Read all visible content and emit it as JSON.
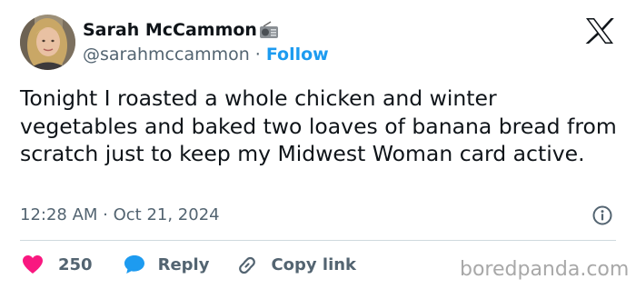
{
  "author": {
    "display_name": "Sarah McCammon",
    "handle": "@sarahmccammon",
    "separator": "·",
    "follow_label": "Follow"
  },
  "tweet": {
    "text": "Tonight I roasted a whole chicken and winter vegetables and baked two loaves of banana bread from scratch just to keep my Midwest Woman card active.",
    "timestamp": "12:28 AM · Oct 21, 2024"
  },
  "actions": {
    "like_count": "250",
    "reply_label": "Reply",
    "copy_link_label": "Copy link"
  },
  "watermark": "boredpanda.com",
  "icons": {
    "brand": "x-logo-icon",
    "badge": "radio-icon",
    "like": "heart-icon",
    "reply": "speech-bubble-icon",
    "copy": "link-icon",
    "info": "info-icon"
  },
  "colors": {
    "text": "#0f1419",
    "secondary": "#536471",
    "follow": "#1d9bf0",
    "like": "#f91880",
    "reply": "#1d9bf0",
    "divider": "#cfd9de",
    "watermark": "#a8a8a8"
  }
}
